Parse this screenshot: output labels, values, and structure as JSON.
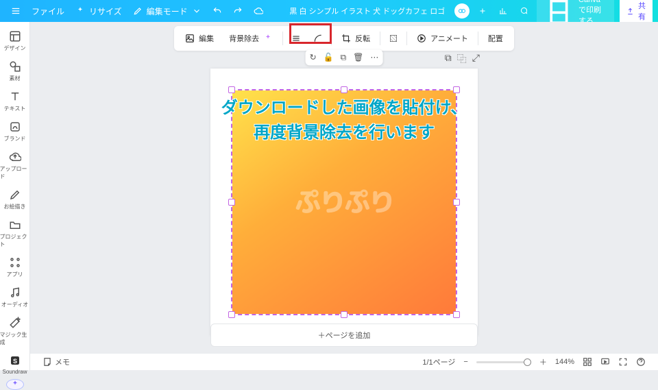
{
  "topbar": {
    "file_label": "ファイル",
    "resize_label": "リサイズ",
    "edit_mode_label": "編集モード",
    "doc_title": "黒 白 シンプル イラスト 犬 ドッグカフェ ロゴ",
    "print_label": "Canvaで印刷する",
    "share_label": "共有"
  },
  "sidebar": {
    "items": [
      {
        "label": "デザイン",
        "icon": "design"
      },
      {
        "label": "素材",
        "icon": "elements"
      },
      {
        "label": "テキスト",
        "icon": "text"
      },
      {
        "label": "ブランド",
        "icon": "brand"
      },
      {
        "label": "アップロード",
        "icon": "upload"
      },
      {
        "label": "お絵描き",
        "icon": "draw"
      },
      {
        "label": "プロジェクト",
        "icon": "projects"
      },
      {
        "label": "アプリ",
        "icon": "apps"
      },
      {
        "label": "オーディオ",
        "icon": "audio"
      },
      {
        "label": "マジック生成",
        "icon": "magic"
      },
      {
        "label": "Soundraw",
        "icon": "soundraw"
      }
    ]
  },
  "ctxbar": {
    "edit": "編集",
    "bg_remove": "背景除去",
    "flip": "反転",
    "animate": "アニメート",
    "position": "配置"
  },
  "floating_tools": {
    "sync": "↻",
    "lock": "🔓",
    "copy": "⧉",
    "trash": "🗑",
    "more": "⋯"
  },
  "annotation": {
    "line1": "ダウンロードした画像を貼付け、",
    "line2": "再度背景除去を行います"
  },
  "watermark": "ぷりぷり",
  "add_page": "＋ページを追加",
  "footer": {
    "notes": "メモ",
    "page_indicator": "1/1ページ",
    "zoom": "144%"
  }
}
